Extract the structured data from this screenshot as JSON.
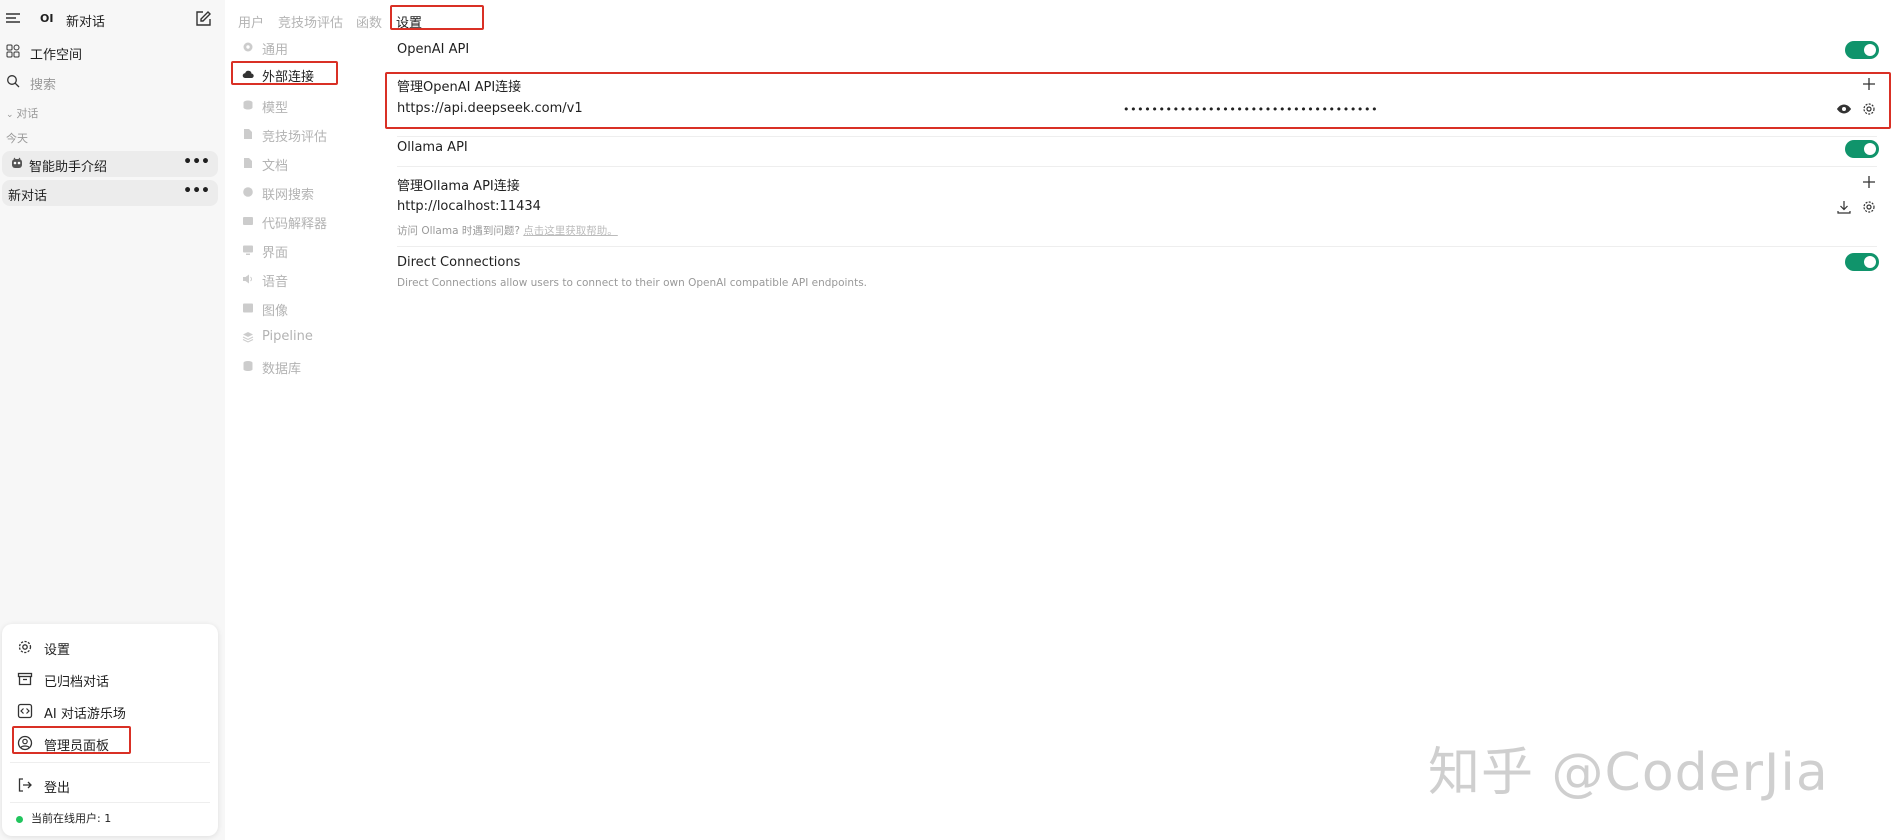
{
  "sidebar": {
    "logo": "OI",
    "new_chat": "新对话",
    "workspace": "工作空间",
    "search": "搜索",
    "section_chats": "对话",
    "section_today": "今天",
    "chats": [
      {
        "title": "智能助手介绍",
        "icon": "robot-icon"
      },
      {
        "title": "新对话"
      }
    ],
    "more_label": "•••",
    "menu": {
      "settings": "设置",
      "archived": "已归档对话",
      "playground": "AI 对话游乐场",
      "admin_panel": "管理员面板",
      "logout": "登出",
      "online_users": "当前在线用户: 1"
    }
  },
  "tabs": [
    "用户",
    "竞技场评估",
    "函数",
    "设置"
  ],
  "settings_nav": [
    {
      "label": "通用",
      "icon": "gear-icon"
    },
    {
      "label": "外部连接",
      "icon": "cloud-icon"
    },
    {
      "label": "模型",
      "icon": "cube-icon"
    },
    {
      "label": "竞技场评估",
      "icon": "document-icon"
    },
    {
      "label": "文档",
      "icon": "file-icon"
    },
    {
      "label": "联网搜索",
      "icon": "globe-icon"
    },
    {
      "label": "代码解释器",
      "icon": "terminal-icon"
    },
    {
      "label": "界面",
      "icon": "monitor-icon"
    },
    {
      "label": "语音",
      "icon": "speaker-icon"
    },
    {
      "label": "图像",
      "icon": "image-icon"
    },
    {
      "label": "Pipeline",
      "icon": "layers-icon"
    },
    {
      "label": "数据库",
      "icon": "database-icon"
    }
  ],
  "main": {
    "openai_api": {
      "label": "OpenAI API",
      "enabled": true
    },
    "manage_openai": {
      "label": "管理OpenAI API连接",
      "url": "https://api.deepseek.com/v1",
      "key_masked": "••••••••••••••••••••••••••••••••••••"
    },
    "ollama_api": {
      "label": "Ollama API",
      "enabled": true
    },
    "manage_ollama": {
      "label": "管理Ollama API连接",
      "url": "http://localhost:11434",
      "help_text": "访问 Ollama 时遇到问题?",
      "help_link": "点击这里获取帮助。"
    },
    "direct_connections": {
      "label": "Direct Connections",
      "description": "Direct Connections allow users to connect to their own OpenAI compatible API endpoints.",
      "enabled": true
    }
  },
  "watermark": "知乎 @CoderJia",
  "colors": {
    "toggle_on": "#10946b",
    "highlight": "#d93025",
    "online_dot": "#22c55e"
  }
}
